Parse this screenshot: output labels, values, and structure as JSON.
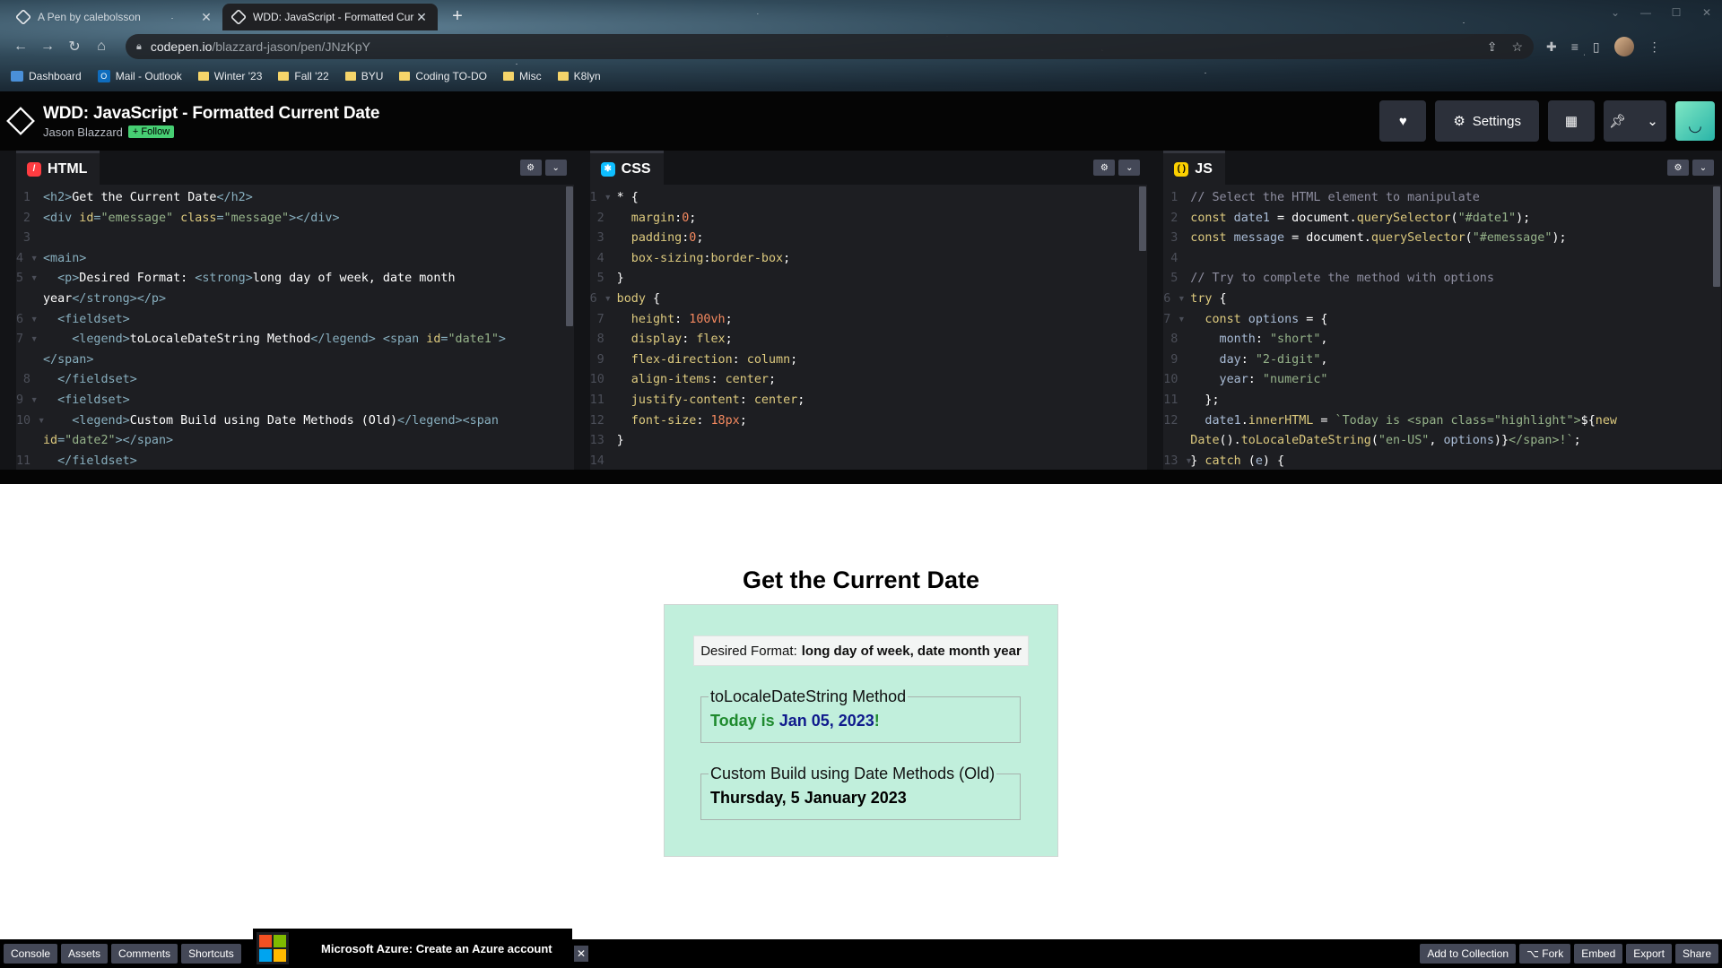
{
  "browser": {
    "tabs": [
      {
        "label": "A Pen by calebolsson"
      },
      {
        "label": "WDD: JavaScript - Formatted Cur"
      }
    ],
    "url_host": "codepen.io",
    "url_path": "/blazzard-jason/pen/JNzKpY",
    "bookmarks": [
      {
        "label": "Dashboard",
        "icon": "dashboard-icon"
      },
      {
        "label": "Mail - Outlook",
        "icon": "outlook-icon"
      },
      {
        "label": "Winter '23",
        "icon": "folder-icon"
      },
      {
        "label": "Fall '22",
        "icon": "folder-icon"
      },
      {
        "label": "BYU",
        "icon": "folder-icon"
      },
      {
        "label": "Coding TO-DO",
        "icon": "folder-icon"
      },
      {
        "label": "Misc",
        "icon": "folder-icon"
      },
      {
        "label": "K8lyn",
        "icon": "folder-icon"
      }
    ]
  },
  "header": {
    "title": "WDD: JavaScript - Formatted Current Date",
    "author": "Jason Blazzard",
    "follow_label": "+ Follow",
    "settings_label": "Settings"
  },
  "editors": {
    "html": {
      "label": "HTML"
    },
    "css": {
      "label": "CSS"
    },
    "js": {
      "label": "JS"
    }
  },
  "preview": {
    "heading": "Get the Current Date",
    "desired_prefix": "Desired Format:",
    "desired_value": "long day of week, date month year",
    "legend1": "toLocaleDateString Method",
    "today_prefix": "Today is ",
    "today_value": "Jan 05, 2023",
    "today_suffix": "!",
    "legend2": "Custom Build using Date Methods (Old)",
    "custom_value": "Thursday, 5 January 2023"
  },
  "footer": {
    "console": "Console",
    "assets": "Assets",
    "comments": "Comments",
    "shortcuts": "Shortcuts",
    "ad_text": "Microsoft Azure: Create an Azure account",
    "add_to_collection": "Add to Collection",
    "fork": "⌥ Fork",
    "embed": "Embed",
    "export": "Export",
    "share": "Share"
  },
  "colors": {
    "accent_green": "#47cf73",
    "preview_bg": "#c1efdc",
    "editor_bg": "#1d1e22"
  }
}
